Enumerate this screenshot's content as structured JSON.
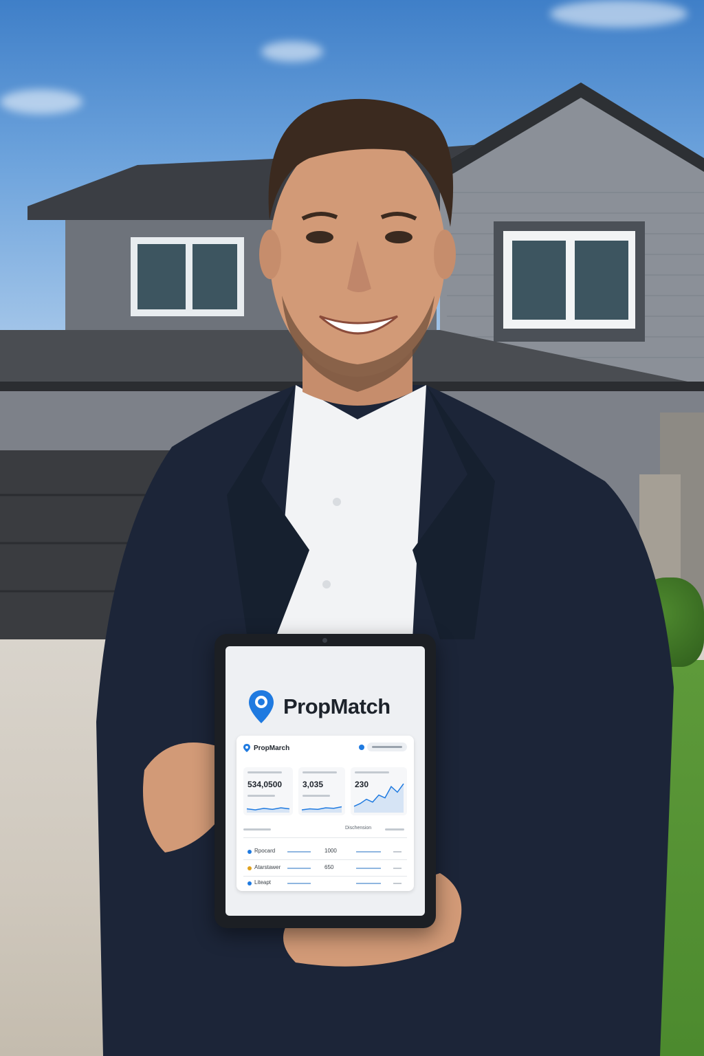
{
  "tablet": {
    "brand": "PropMatch",
    "app": {
      "title": "PropMarch",
      "stats": [
        {
          "value": "534,0500",
          "trend": [
            0.3,
            0.2,
            0.35,
            0.25,
            0.4,
            0.3
          ]
        },
        {
          "value": "3,035",
          "trend": [
            0.2,
            0.3,
            0.25,
            0.4,
            0.35,
            0.5
          ]
        },
        {
          "value": "230",
          "trend": [
            0.2,
            0.3,
            0.45,
            0.35,
            0.6,
            0.5,
            0.9,
            0.7,
            1.0
          ]
        }
      ],
      "table_header": "Dischension",
      "rows": [
        {
          "name": "Rpocard",
          "number": "1000",
          "icon_color": "#1f7ae0"
        },
        {
          "name": "Atarstawer",
          "number": "650",
          "icon_color": "#e0a21f"
        },
        {
          "name": "Liteapt",
          "number": "",
          "icon_color": "#1f7ae0"
        }
      ]
    }
  },
  "colors": {
    "brand_blue": "#1f7ae0",
    "suit": "#1c2538",
    "siding": "#7b8088"
  }
}
